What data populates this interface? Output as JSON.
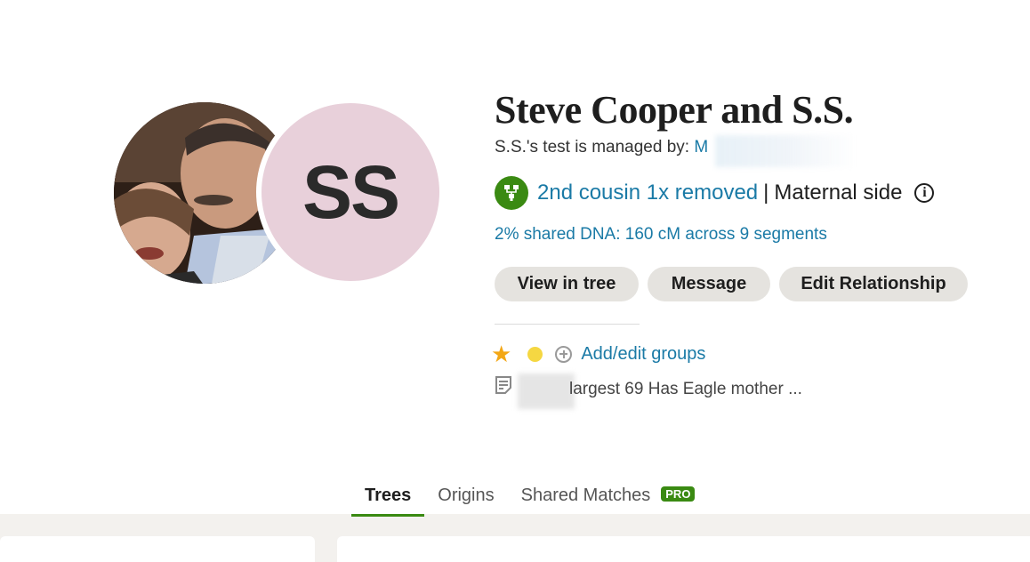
{
  "profile": {
    "initials": "SS",
    "name": "Steve Cooper and S.S.",
    "managed_prefix": "S.S.'s test is managed by: ",
    "manager_name": "M",
    "relationship": "2nd cousin 1x removed",
    "separator": "|",
    "side": "Maternal side",
    "shared_dna": "2% shared DNA: 160 cM across 9 segments"
  },
  "actions": {
    "view_in_tree": "View in tree",
    "message": "Message",
    "edit_relationship": "Edit Relationship"
  },
  "groups": {
    "add_edit_label": "Add/edit groups"
  },
  "note": {
    "text": "largest 69 Has Eagle mother ..."
  },
  "tabs": [
    {
      "label": "Trees",
      "active": true
    },
    {
      "label": "Origins",
      "active": false
    },
    {
      "label": "Shared Matches",
      "active": false,
      "badge": "PRO"
    }
  ],
  "colors": {
    "link": "#1a7aa6",
    "accent_green": "#3a8a12",
    "avatar_pink": "#e8d0da",
    "button_bg": "#e5e3df",
    "star": "#f3a716",
    "group_dot": "#f5d742"
  },
  "icons": {
    "relationship": "dna-tree-icon",
    "info": "info-icon",
    "star": "star-icon",
    "group": "group-dot-icon",
    "add": "plus-circle-icon",
    "note": "note-icon"
  }
}
